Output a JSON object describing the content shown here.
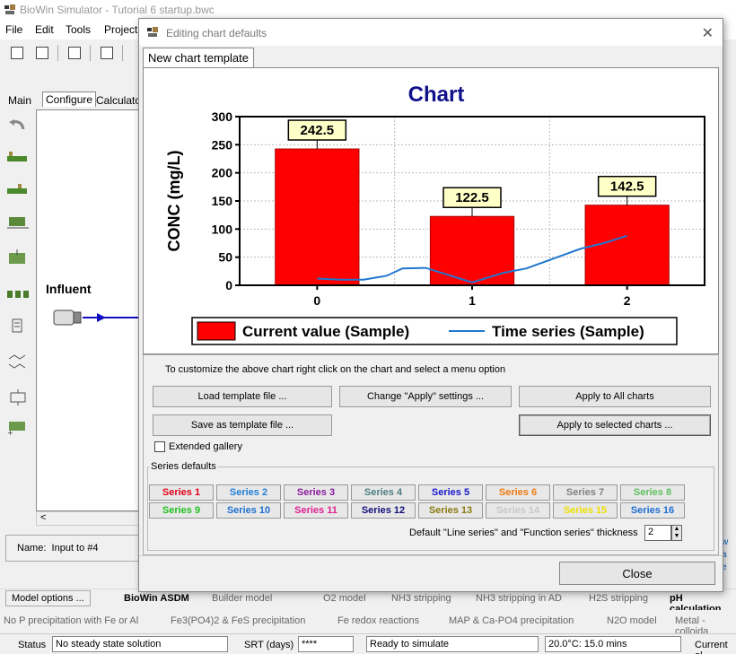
{
  "window": {
    "title": "BioWin Simulator - Tutorial 6 startup.bwc"
  },
  "menu": {
    "items": [
      "File",
      "Edit",
      "Tools",
      "Project"
    ]
  },
  "left_tabs": [
    "Main",
    "Configure",
    "Calculator"
  ],
  "canvas": {
    "influent_label": "Influent"
  },
  "name_bar": {
    "label": "Name:",
    "value": "Input to #4"
  },
  "right_links": [
    "w",
    "a",
    "e"
  ],
  "dialog": {
    "title": "Editing chart defaults",
    "tab": "New chart template",
    "hint": "To customize the above chart right click on the chart and select a menu option",
    "buttons": {
      "load": "Load template file ...",
      "change_apply": "Change \"Apply\" settings ...",
      "apply_all": "Apply to All charts",
      "save": "Save as template file ...",
      "apply_selected": "Apply to selected charts ..."
    },
    "extended_gallery": "Extended gallery",
    "series_defaults_title": "Series defaults",
    "series": [
      {
        "label": "Series 1",
        "color": "#e0001a"
      },
      {
        "label": "Series 2",
        "color": "#1f7fd6"
      },
      {
        "label": "Series 3",
        "color": "#8a1a9c"
      },
      {
        "label": "Series 4",
        "color": "#4f7f80"
      },
      {
        "label": "Series 5",
        "color": "#1616c8"
      },
      {
        "label": "Series 6",
        "color": "#f07a10"
      },
      {
        "label": "Series 7",
        "color": "#808080"
      },
      {
        "label": "Series 8",
        "color": "#60c060"
      },
      {
        "label": "Series 9",
        "color": "#20c020"
      },
      {
        "label": "Series 10",
        "color": "#1f6fd0"
      },
      {
        "label": "Series 11",
        "color": "#e02090"
      },
      {
        "label": "Series 12",
        "color": "#10107a"
      },
      {
        "label": "Series 13",
        "color": "#8a7a10"
      },
      {
        "label": "Series 14",
        "color": "#c8c8c8"
      },
      {
        "label": "Series 15",
        "color": "#f0e000"
      },
      {
        "label": "Series 16",
        "color": "#1f6fd0"
      }
    ],
    "thickness_label": "Default \"Line series\" and \"Function series\" thickness",
    "thickness_value": "2",
    "close": "Close"
  },
  "chart_data": {
    "type": "bar",
    "title": "Chart",
    "ylabel": "CONC (mg/L)",
    "xlabel": "",
    "categories": [
      "0",
      "1",
      "2"
    ],
    "ylim": [
      0,
      300
    ],
    "yticks": [
      "0",
      "50",
      "100",
      "150",
      "200",
      "250",
      "300"
    ],
    "series": [
      {
        "name": "Current value (Sample)",
        "type": "bar",
        "values": [
          242.5,
          122.5,
          142.5
        ],
        "labels": [
          "242.5",
          "122.5",
          "142.5"
        ],
        "color": "#ff0000"
      },
      {
        "name": "Time series (Sample)",
        "type": "line",
        "x": [
          0,
          0.15,
          0.3,
          0.45,
          0.55,
          0.7,
          0.85,
          1.0,
          1.2,
          1.35,
          1.5,
          1.7,
          1.85,
          2.0
        ],
        "values": [
          12,
          10,
          10,
          17,
          30,
          31,
          18,
          5,
          22,
          30,
          45,
          65,
          75,
          88
        ],
        "color": "#1f77d0"
      }
    ],
    "grid": true,
    "legend": "bottom"
  },
  "bottom_tabs": {
    "model_options": "Model options ...",
    "row1": [
      "BioWin ASDM",
      "Builder model",
      "O2 model",
      "NH3 stripping",
      "NH3 stripping in AD",
      "H2S stripping",
      "pH calculation"
    ],
    "row2": [
      "No P precipitation with Fe or Al",
      "Fe3(PO4)2 & FeS precipitation",
      "Fe redox reactions",
      "MAP & Ca-PO4 precipitation",
      "N2O model",
      "Metal - colloida"
    ]
  },
  "status": {
    "label": "Status",
    "state": "No steady state solution",
    "srt_label": "SRT (days)",
    "srt_value": "****",
    "ready": "Ready to simulate",
    "temp": "20.0°C: 15.0 mins",
    "current": "Current al"
  }
}
